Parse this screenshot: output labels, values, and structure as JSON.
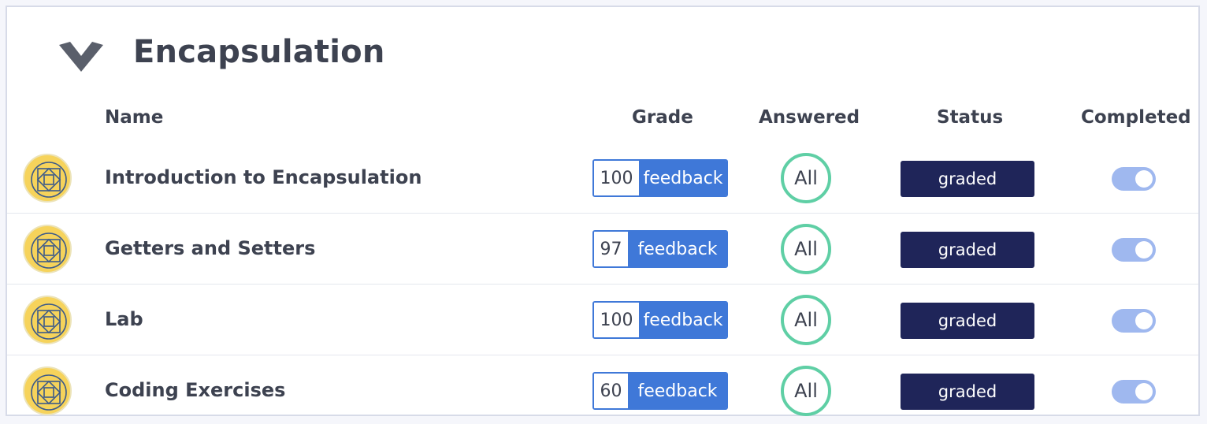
{
  "section": {
    "title": "Encapsulation",
    "collapse_icon": "chevron-down-icon"
  },
  "columns": {
    "name": "Name",
    "grade": "Grade",
    "answered": "Answered",
    "status": "Status",
    "completed": "Completed"
  },
  "colors": {
    "accent_blue": "#3f78d8",
    "answered_ring": "#5fcfa5",
    "status_bg": "#1f2559",
    "toggle_on": "#9fb8ef",
    "badge_yellow": "#f6d35b"
  },
  "rows": [
    {
      "icon": "assignment-badge-icon",
      "name": "Introduction to Encapsulation",
      "grade": "100",
      "feedback": "feedback",
      "answered": "All",
      "status": "graded",
      "completed": true
    },
    {
      "icon": "assignment-badge-icon",
      "name": "Getters and Setters",
      "grade": "97",
      "feedback": "feedback",
      "answered": "All",
      "status": "graded",
      "completed": true
    },
    {
      "icon": "assignment-badge-icon",
      "name": "Lab",
      "grade": "100",
      "feedback": "feedback",
      "answered": "All",
      "status": "graded",
      "completed": true
    },
    {
      "icon": "assignment-badge-icon",
      "name": "Coding Exercises",
      "grade": "60",
      "feedback": "feedback",
      "answered": "All",
      "status": "graded",
      "completed": true
    }
  ]
}
